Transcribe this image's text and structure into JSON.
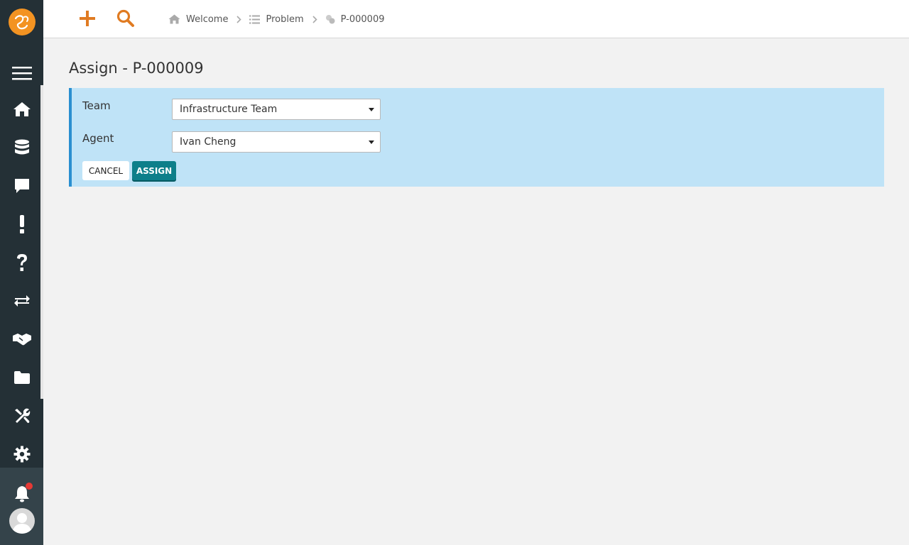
{
  "sidebar": {
    "items": [
      {
        "icon": "menu-icon"
      },
      {
        "icon": "home-icon"
      },
      {
        "icon": "database-icon"
      },
      {
        "icon": "chat-icon"
      },
      {
        "icon": "exclamation-icon"
      },
      {
        "icon": "question-icon"
      },
      {
        "icon": "exchange-icon"
      },
      {
        "icon": "handshake-icon"
      },
      {
        "icon": "folder-icon"
      },
      {
        "icon": "tools-icon"
      },
      {
        "icon": "gear-icon"
      }
    ],
    "notification_icon": "bell-icon",
    "has_notification": true
  },
  "topbar": {
    "add_icon": "plus-icon",
    "search_icon": "search-icon",
    "accent_color": "#e07b22"
  },
  "breadcrumb": [
    {
      "label": "Welcome",
      "icon": "home-icon"
    },
    {
      "label": "Problem",
      "icon": "list-icon"
    },
    {
      "label": "P-000009",
      "icon": "problem-icon"
    }
  ],
  "page": {
    "title": "Assign - P-000009"
  },
  "form": {
    "team_label": "Team",
    "team_value": "Infrastructure Team",
    "agent_label": "Agent",
    "agent_value": "Ivan Cheng",
    "cancel_label": "CANCEL",
    "assign_label": "ASSIGN"
  },
  "colors": {
    "sidebar_bg": "#243036",
    "panel_bg": "#bfe3f7",
    "assign_button": "#0d7f8a",
    "logo": "#f39322"
  }
}
